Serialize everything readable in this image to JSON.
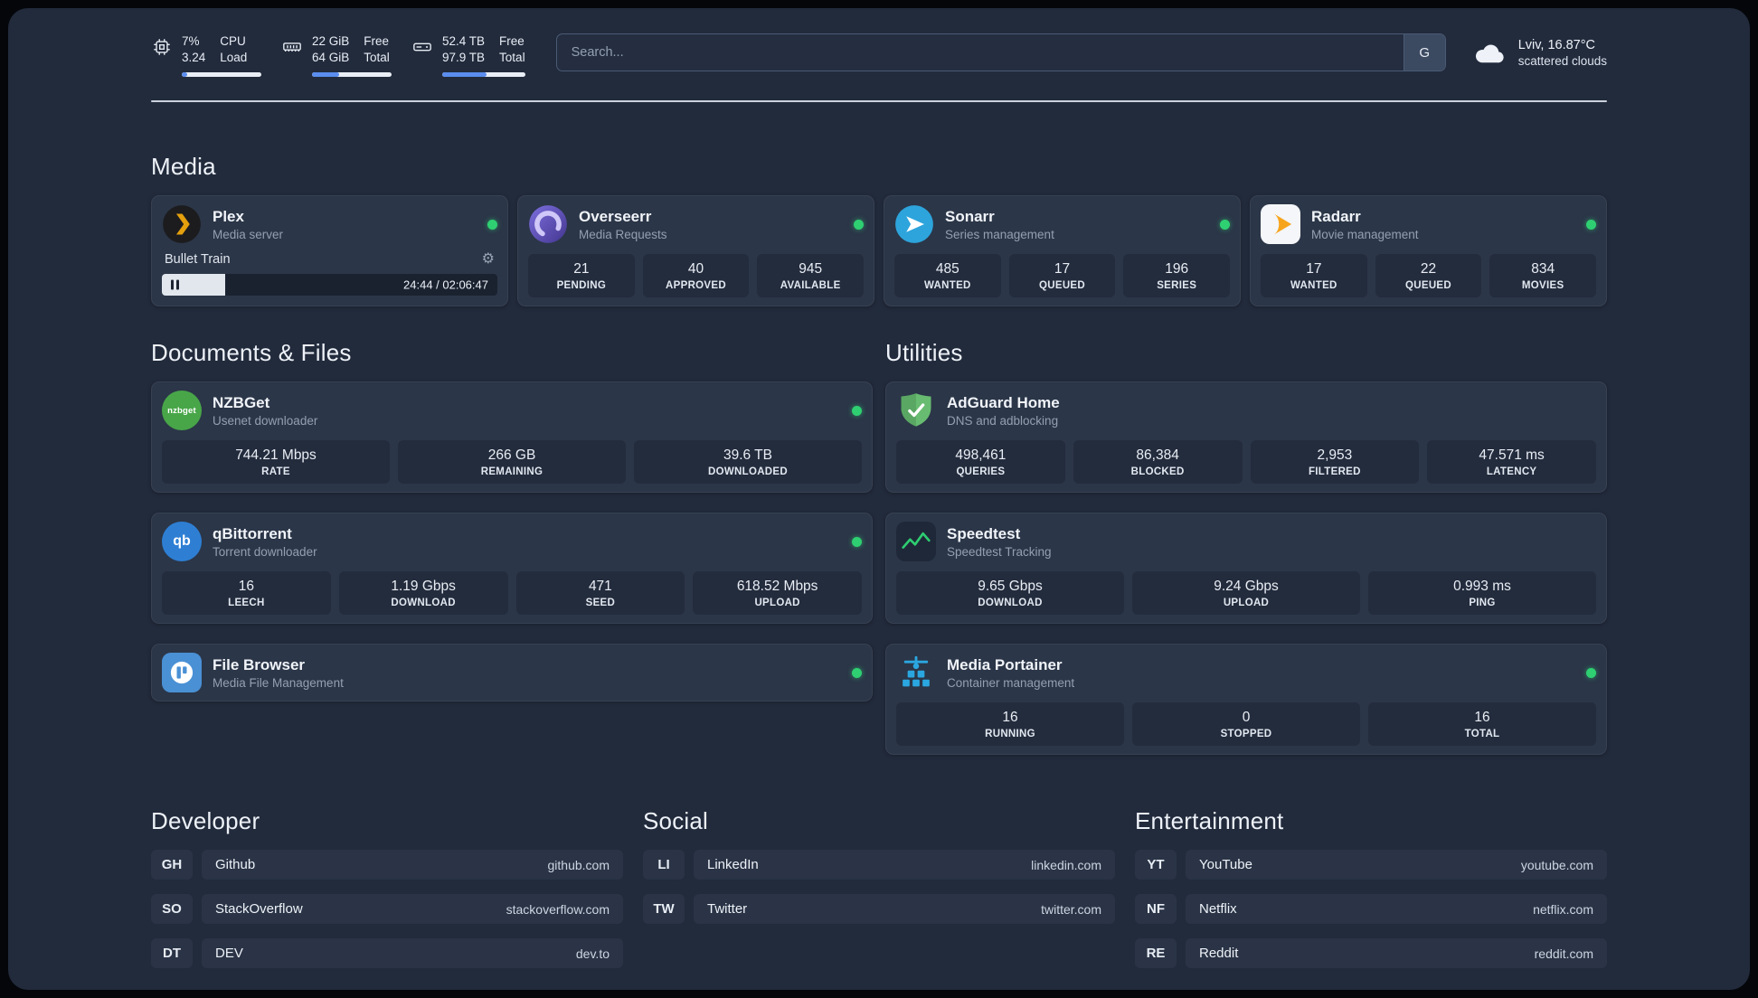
{
  "topbar": {
    "cpu": {
      "value": "7%",
      "load": "3.24",
      "label_top": "CPU",
      "label_bottom": "Load",
      "progress": 7
    },
    "ram": {
      "free": "22 GiB",
      "total": "64 GiB",
      "label_top": "Free",
      "label_bottom": "Total",
      "progress": 34
    },
    "disk": {
      "free": "52.4 TB",
      "total": "97.9 TB",
      "label_top": "Free",
      "label_bottom": "Total",
      "progress": 53
    },
    "search": {
      "placeholder": "Search...",
      "engine_label": "G"
    },
    "weather": {
      "location": "Lviv, 16.87°C",
      "condition": "scattered clouds"
    }
  },
  "media": {
    "title": "Media",
    "plex": {
      "name": "Plex",
      "subtitle": "Media server",
      "now_playing": "Bullet Train",
      "time": "24:44 / 02:06:47",
      "progress": 19
    },
    "overseerr": {
      "name": "Overseerr",
      "subtitle": "Media Requests",
      "stats": [
        {
          "value": "21",
          "label": "PENDING"
        },
        {
          "value": "40",
          "label": "APPROVED"
        },
        {
          "value": "945",
          "label": "AVAILABLE"
        }
      ]
    },
    "sonarr": {
      "name": "Sonarr",
      "subtitle": "Series management",
      "stats": [
        {
          "value": "485",
          "label": "WANTED"
        },
        {
          "value": "17",
          "label": "QUEUED"
        },
        {
          "value": "196",
          "label": "SERIES"
        }
      ]
    },
    "radarr": {
      "name": "Radarr",
      "subtitle": "Movie management",
      "stats": [
        {
          "value": "17",
          "label": "WANTED"
        },
        {
          "value": "22",
          "label": "QUEUED"
        },
        {
          "value": "834",
          "label": "MOVIES"
        }
      ]
    }
  },
  "documents": {
    "title": "Documents & Files",
    "nzbget": {
      "name": "NZBGet",
      "subtitle": "Usenet downloader",
      "icon_text": "nzbget",
      "stats": [
        {
          "value": "744.21 Mbps",
          "label": "RATE"
        },
        {
          "value": "266 GB",
          "label": "REMAINING"
        },
        {
          "value": "39.6 TB",
          "label": "DOWNLOADED"
        }
      ]
    },
    "qbittorrent": {
      "name": "qBittorrent",
      "subtitle": "Torrent downloader",
      "icon_text": "qb",
      "stats": [
        {
          "value": "16",
          "label": "LEECH"
        },
        {
          "value": "1.19 Gbps",
          "label": "DOWNLOAD"
        },
        {
          "value": "471",
          "label": "SEED"
        },
        {
          "value": "618.52 Mbps",
          "label": "UPLOAD"
        }
      ]
    },
    "filebrowser": {
      "name": "File Browser",
      "subtitle": "Media File Management"
    }
  },
  "utilities": {
    "title": "Utilities",
    "adguard": {
      "name": "AdGuard Home",
      "subtitle": "DNS and adblocking",
      "stats": [
        {
          "value": "498,461",
          "label": "QUERIES"
        },
        {
          "value": "86,384",
          "label": "BLOCKED"
        },
        {
          "value": "2,953",
          "label": "FILTERED"
        },
        {
          "value": "47.571 ms",
          "label": "LATENCY"
        }
      ]
    },
    "speedtest": {
      "name": "Speedtest",
      "subtitle": "Speedtest Tracking",
      "stats": [
        {
          "value": "9.65 Gbps",
          "label": "DOWNLOAD"
        },
        {
          "value": "9.24 Gbps",
          "label": "UPLOAD"
        },
        {
          "value": "0.993 ms",
          "label": "PING"
        }
      ]
    },
    "portainer": {
      "name": "Media Portainer",
      "subtitle": "Container management",
      "stats": [
        {
          "value": "16",
          "label": "RUNNING"
        },
        {
          "value": "0",
          "label": "STOPPED"
        },
        {
          "value": "16",
          "label": "TOTAL"
        }
      ]
    }
  },
  "bookmarks": [
    {
      "title": "Developer",
      "links": [
        {
          "abbr": "GH",
          "name": "Github",
          "domain": "github.com"
        },
        {
          "abbr": "SO",
          "name": "StackOverflow",
          "domain": "stackoverflow.com"
        },
        {
          "abbr": "DT",
          "name": "DEV",
          "domain": "dev.to"
        }
      ]
    },
    {
      "title": "Social",
      "links": [
        {
          "abbr": "LI",
          "name": "LinkedIn",
          "domain": "linkedin.com"
        },
        {
          "abbr": "TW",
          "name": "Twitter",
          "domain": "twitter.com"
        }
      ]
    },
    {
      "title": "Entertainment",
      "links": [
        {
          "abbr": "YT",
          "name": "YouTube",
          "domain": "youtube.com"
        },
        {
          "abbr": "NF",
          "name": "Netflix",
          "domain": "netflix.com"
        },
        {
          "abbr": "RE",
          "name": "Reddit",
          "domain": "reddit.com"
        }
      ]
    }
  ],
  "colors": {
    "status_ok": "#2fd072",
    "accent": "#5b8def"
  }
}
